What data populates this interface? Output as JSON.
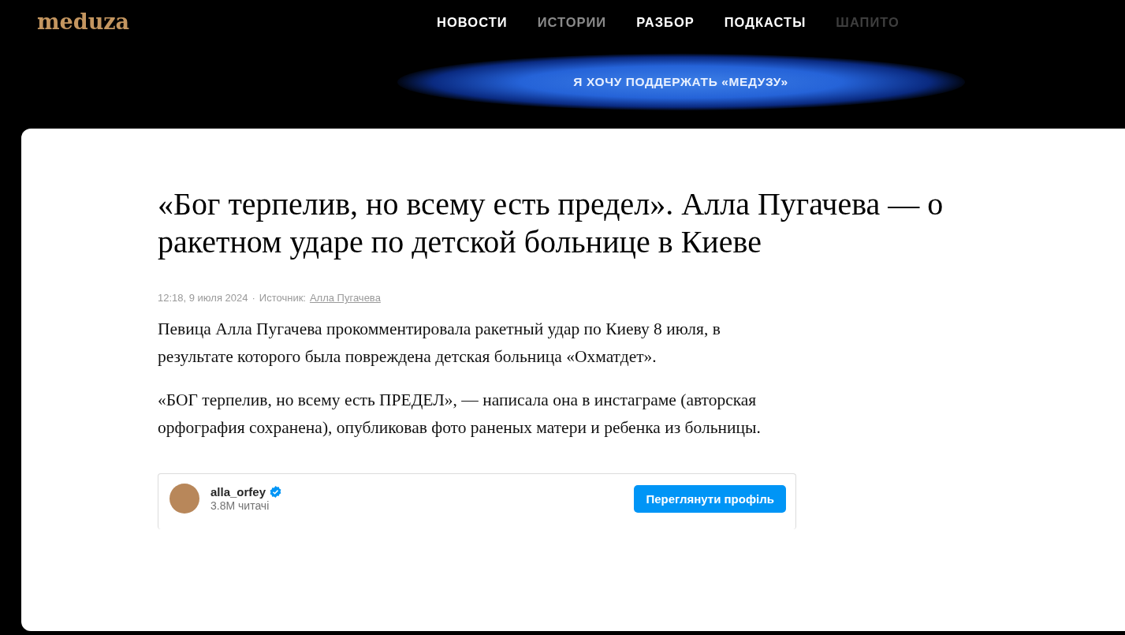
{
  "header": {
    "logo": "meduza",
    "nav": [
      {
        "label": "НОВОСТИ",
        "kind": "bright"
      },
      {
        "label": "ИСТОРИИ",
        "kind": "muted"
      },
      {
        "label": "РАЗБОР",
        "kind": "bright"
      },
      {
        "label": "ПОДКАСТЫ",
        "kind": "bright"
      },
      {
        "label": "ШАПИТО",
        "kind": "faint"
      }
    ],
    "support_button": "Я ХОЧУ ПОДДЕРЖАТЬ «МЕДУЗУ»"
  },
  "article": {
    "title": "«Бог терпелив, но всему есть предел». Алла Пугачева — о ракетном ударе по детской больнице в Киеве",
    "meta": {
      "time": "12:18, 9 июля 2024",
      "separator": "·",
      "source_label": "Источник:",
      "source_link": "Алла Пугачева"
    },
    "paragraphs": [
      "Певица Алла Пугачева прокомментировала ракетный удар по Киеву 8 июля, в результате которого была повреждена детская больница «Охматдет».",
      "«БОГ терпелив, но всему есть ПРЕДЕЛ», — написала она в инстаграме (авторская орфография сохранена), опубликовав фото раненых матери и ребенка из больницы."
    ],
    "embed": {
      "username": "alla_orfey",
      "verified": true,
      "followers": "3.8M читачі",
      "button": "Переглянути профіль"
    }
  }
}
